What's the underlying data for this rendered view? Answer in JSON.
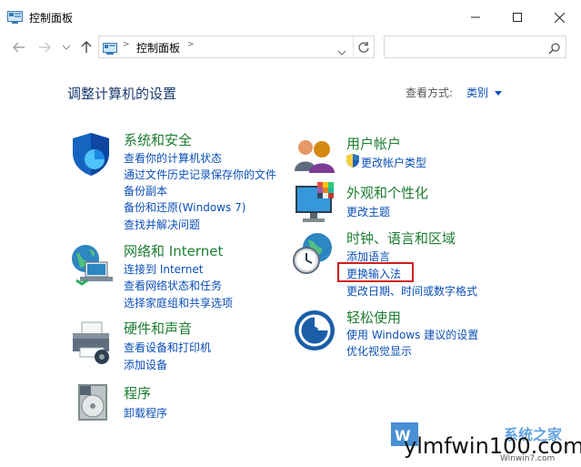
{
  "window": {
    "title": "控制面板"
  },
  "address": {
    "crumb": "控制面板",
    "search_placeholder": ""
  },
  "page": {
    "heading": "调整计算机的设置",
    "view_by_label": "查看方式:",
    "view_by_value": "类别"
  },
  "categories": [
    {
      "title": "系统和安全",
      "links": [
        "查看你的计算机状态",
        "通过文件历史记录保存你的文件",
        "备份副本",
        "备份和还原(Windows 7)",
        "查找并解决问题"
      ]
    },
    {
      "title": "网络和 Internet",
      "links": [
        "连接到 Internet",
        "查看网络状态和任务",
        "选择家庭组和共享选项"
      ]
    },
    {
      "title": "硬件和声音",
      "links": [
        "查看设备和打印机",
        "添加设备"
      ]
    },
    {
      "title": "程序",
      "links": [
        "卸载程序"
      ]
    },
    {
      "title": "用户帐户",
      "links": [
        "更改帐户类型"
      ]
    },
    {
      "title": "外观和个性化",
      "links": [
        "更改主题"
      ]
    },
    {
      "title": "时钟、语言和区域",
      "links": [
        "添加语言",
        "更换输入法",
        "更改日期、时间或数字格式"
      ]
    },
    {
      "title": "轻松使用",
      "links": [
        "使用 Windows 建议的设置",
        "优化视觉显示"
      ]
    }
  ],
  "watermark": {
    "text": "ylmfwin100.com",
    "logo_text": "系统之家",
    "url_text": "Winwin7.com"
  }
}
